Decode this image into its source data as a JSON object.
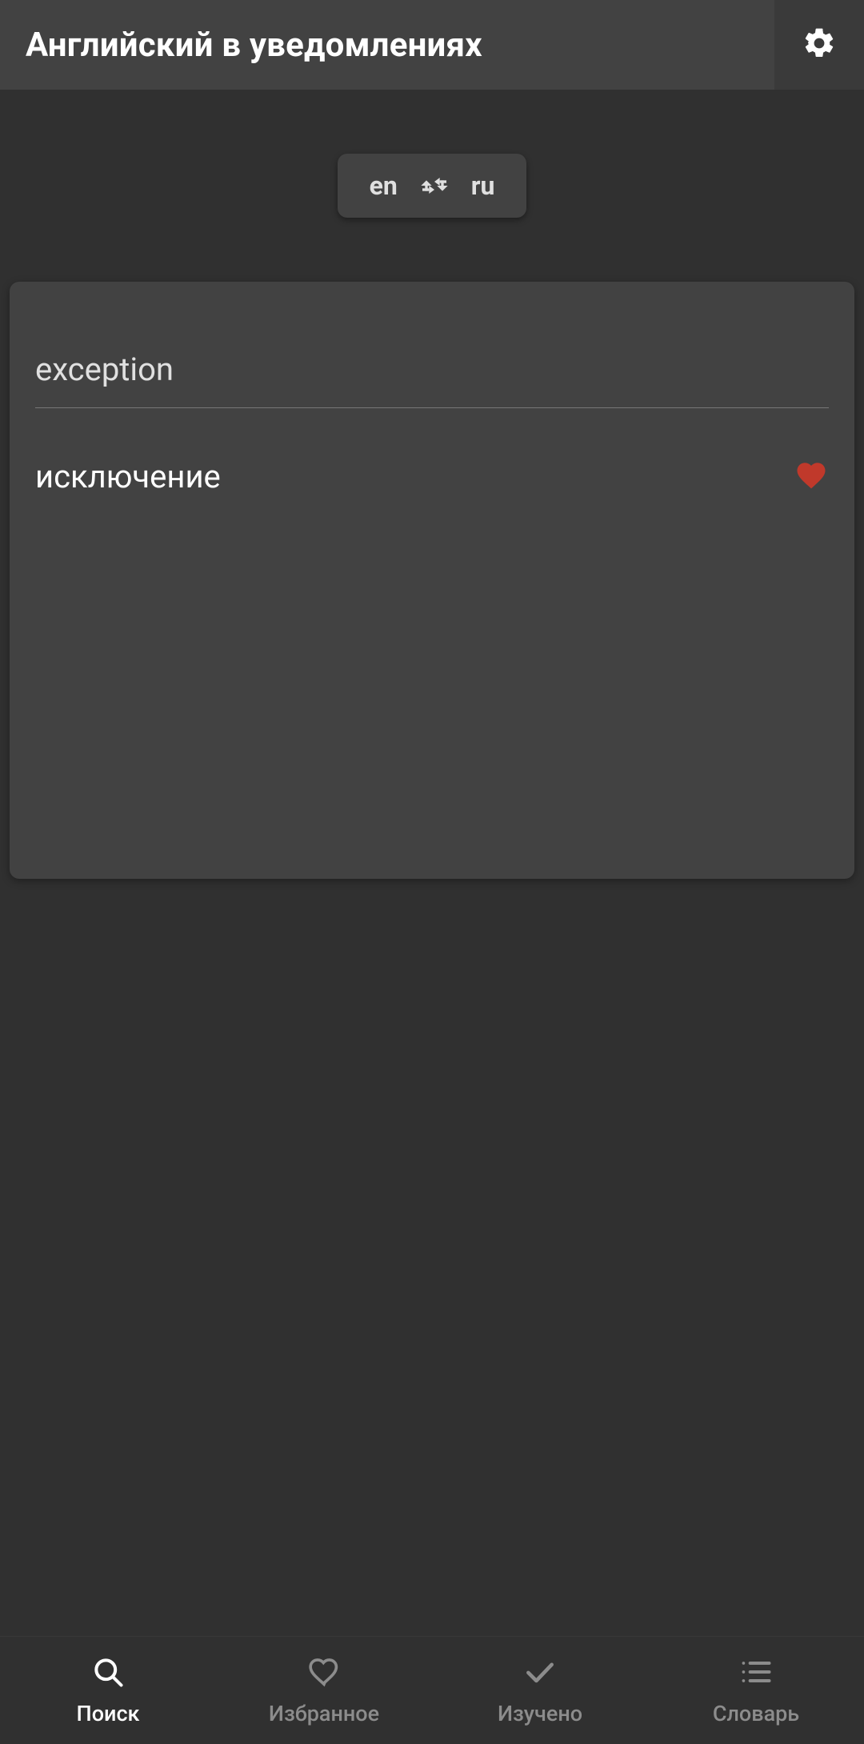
{
  "appbar": {
    "title": "Английский в уведомлениях"
  },
  "lang_switch": {
    "from": "en",
    "to": "ru"
  },
  "search": {
    "value": "exception"
  },
  "result": {
    "translation": "исключение",
    "favorited": true
  },
  "colors": {
    "heart_filled": "#c0392b"
  },
  "bottom_nav": {
    "items": [
      {
        "label": "Поиск",
        "active": true
      },
      {
        "label": "Избранное",
        "active": false
      },
      {
        "label": "Изучено",
        "active": false
      },
      {
        "label": "Словарь",
        "active": false
      }
    ]
  }
}
